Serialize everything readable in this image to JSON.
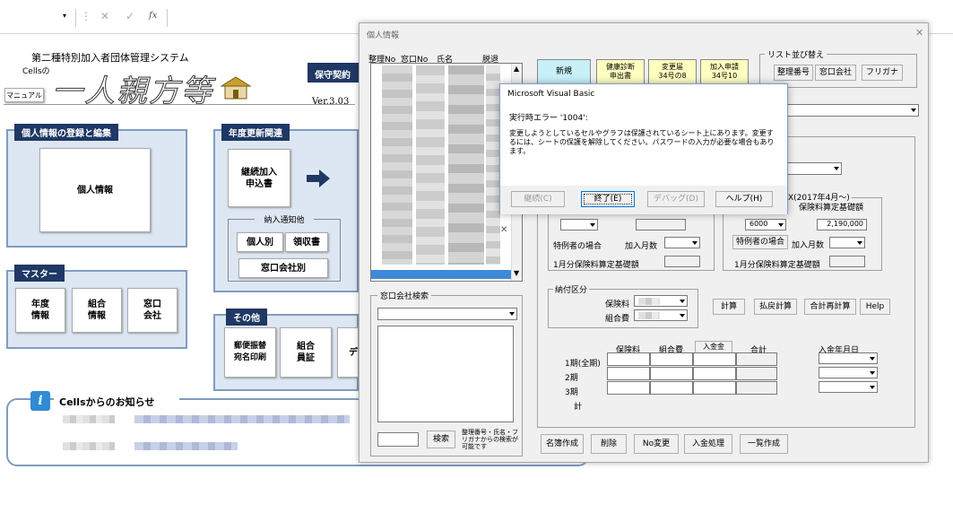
{
  "formula_bar": {
    "fx": "fx"
  },
  "sheet": {
    "system_title": "第二種特別加入者団体管理システム",
    "cells_no": "Cellsの",
    "logo_text": "一人親方等",
    "manual_button": "マニュアル",
    "version": "Ver.3.03",
    "hoshu_button": "保守契約",
    "sections": {
      "personal": {
        "title": "個人情報の登録と編集",
        "button": "個人情報"
      },
      "annual": {
        "title": "年度更新関連",
        "renewal_button": "継続加入\n申込書",
        "notice_label": "納入通知他",
        "individual_button": "個人別",
        "receipt_button": "領収書",
        "window_company_button": "窓口会社別"
      },
      "master": {
        "title": "マスター",
        "year_button": "年度\n情報",
        "union_button": "組合\n情報",
        "window_button": "窓口\n会社"
      },
      "other": {
        "title": "その他",
        "postal_button": "郵便振替\n宛名印刷",
        "union_cert_button": "組合\n員証",
        "partial_button": "デ"
      }
    },
    "news": {
      "title": "Cellsからのお知らせ"
    }
  },
  "dialog": {
    "title": "個人情報",
    "list_headers": [
      "整理No",
      "窓口No",
      "氏名",
      "脱退"
    ],
    "buttons": {
      "new": "新規",
      "health": "健康診断\n申出書",
      "change": "変更届\n34号の8",
      "join": "加入申請\n34号10"
    },
    "sort": {
      "label": "リスト並び替え",
      "by_number": "整理番号",
      "by_company": "窓口会社",
      "by_kana": "フリガナ"
    },
    "company_search": {
      "label": "窓口会社検索"
    },
    "search_button": "検索",
    "search_note": "整理番号・氏名・フリガナからの検索が可能です",
    "insurance_2017": "X(2017年4月〜)",
    "insured_base_label": "保険料算定基礎額",
    "daily_amount": "6000",
    "base_amount": "2,190,000",
    "special_case": "特例者の場合",
    "join_months": "加入月数",
    "first_month_base": "1月分保険料算定基礎額",
    "payment": {
      "label": "納付区分",
      "premium": "保険料",
      "union_fee": "組合費"
    },
    "calc_buttons": {
      "calc": "計算",
      "refund": "払戻計算",
      "total": "合計再計算",
      "help": "Help"
    },
    "table": {
      "headers": [
        "保険料",
        "組合費",
        "入金金",
        "合計",
        "入金年月日"
      ],
      "rows": [
        "1期(全期)",
        "2期",
        "3期",
        "計"
      ]
    },
    "bottom_buttons": [
      "名簿作成",
      "削除",
      "No変更",
      "入金処理",
      "一覧作成"
    ]
  },
  "msgbox": {
    "title": "Microsoft Visual Basic",
    "error": "実行時エラー '1004':",
    "message": "変更しようとしているセルやグラフは保護されているシート上にあります。変更するには、シートの保護を解除してください。パスワードの入力が必要な場合もあります。",
    "buttons": [
      "継続(C)",
      "終了(E)",
      "デバッグ(D)",
      "ヘルプ(H)"
    ]
  }
}
